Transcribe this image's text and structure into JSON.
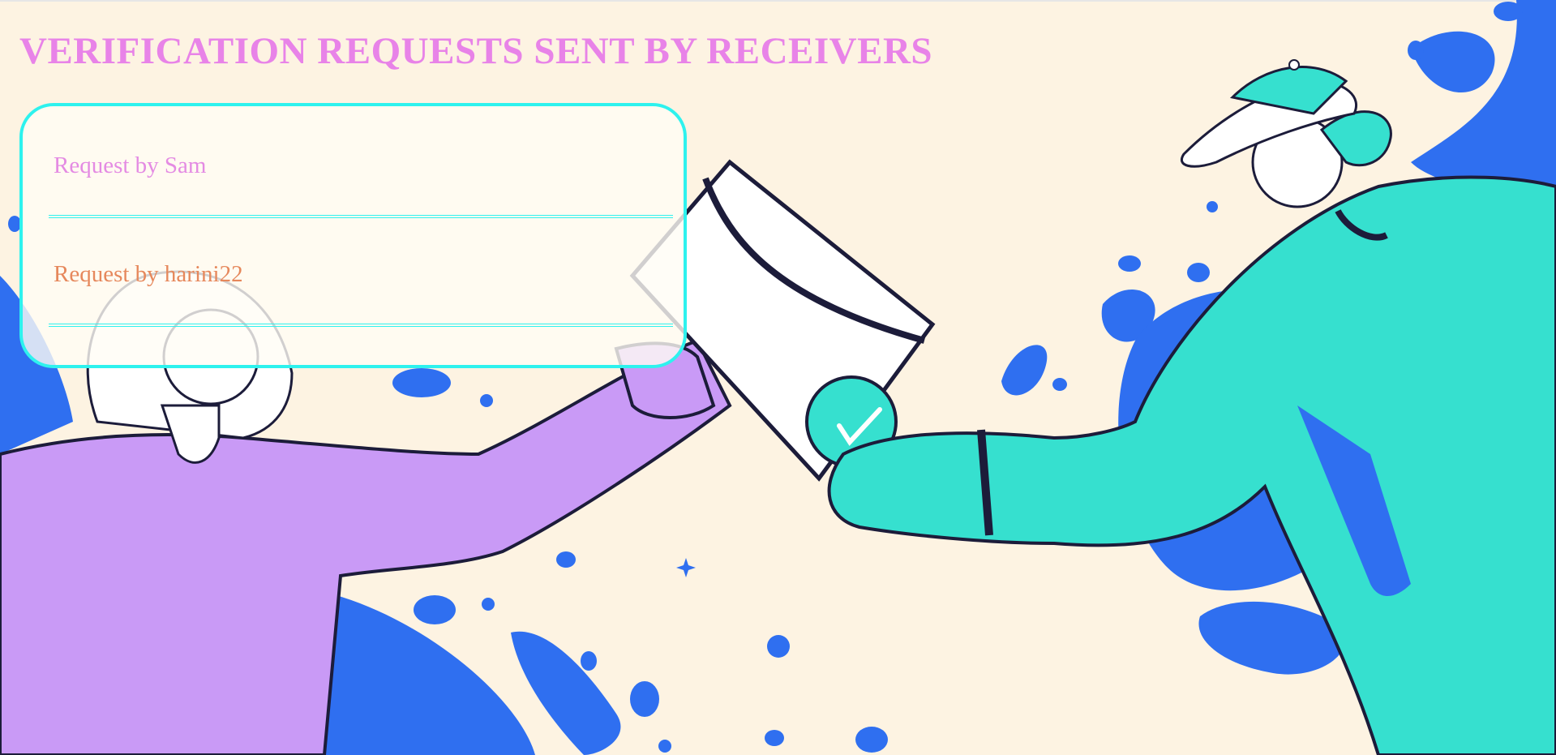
{
  "page": {
    "title": "VERIFICATION REQUESTS SENT BY RECEIVERS"
  },
  "requests": [
    {
      "label": "Request by Sam",
      "color": "#e48be3"
    },
    {
      "label": "Request by harini22",
      "color": "#e6885c"
    }
  ],
  "colors": {
    "background": "#fdf3e2",
    "title": "#e883e8",
    "card_border": "#2ef2ee",
    "illustration_purple": "#c99af6",
    "illustration_teal": "#36e0cf",
    "illustration_blue": "#2f6ff0"
  },
  "illustration": {
    "subject": "background-illustration-two-people-exchanging-verified-envelope"
  }
}
